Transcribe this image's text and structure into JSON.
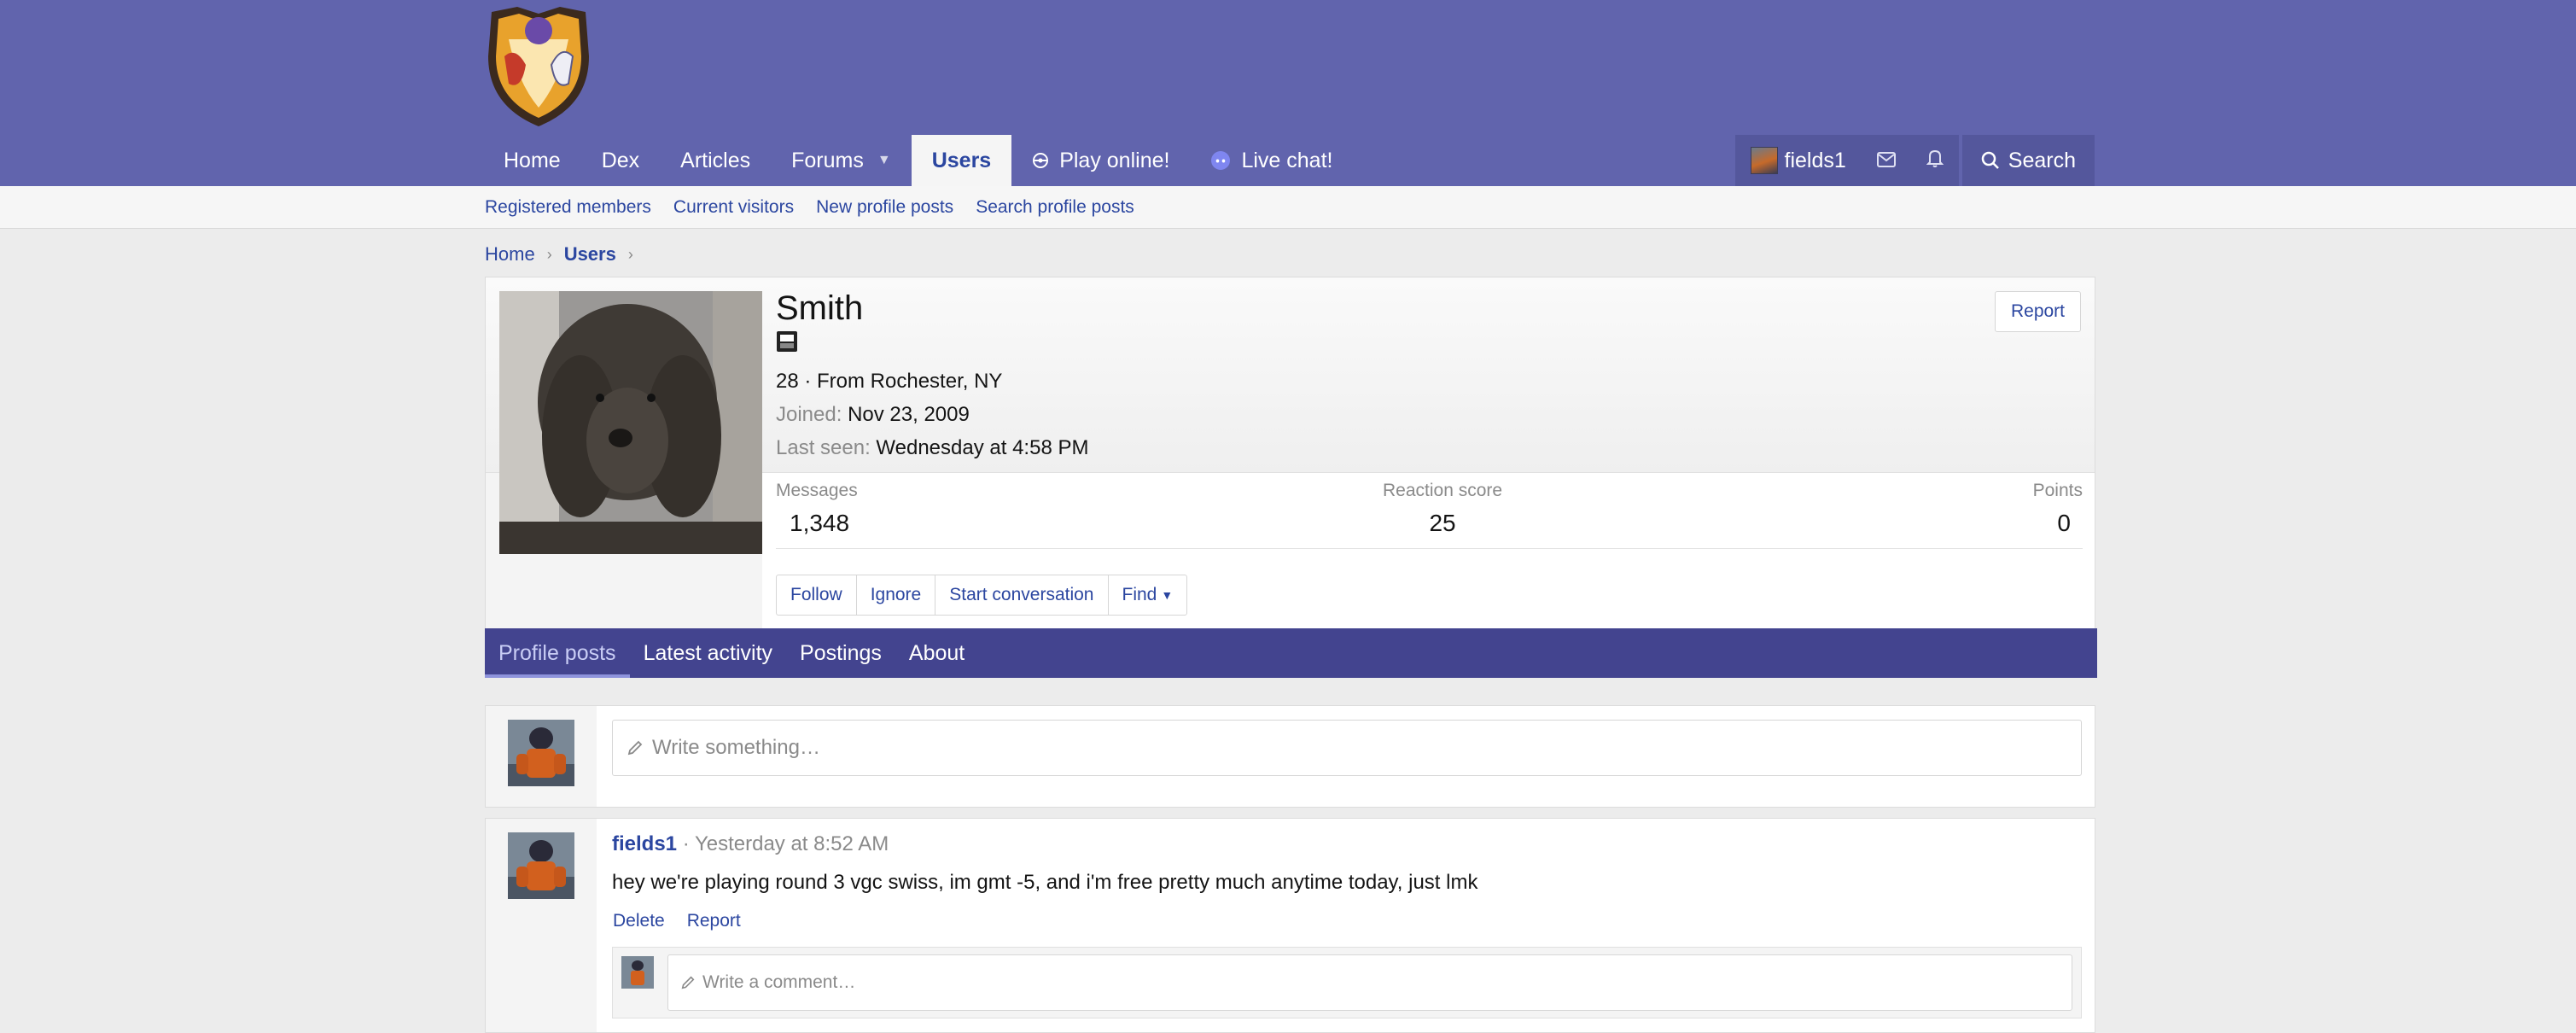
{
  "nav": {
    "items": [
      {
        "label": "Home"
      },
      {
        "label": "Dex"
      },
      {
        "label": "Articles"
      },
      {
        "label": "Forums"
      },
      {
        "label": "Users"
      },
      {
        "label": "Play online!"
      },
      {
        "label": "Live chat!"
      }
    ],
    "account_name": "fields1",
    "search_label": "Search"
  },
  "subnav": [
    "Registered members",
    "Current visitors",
    "New profile posts",
    "Search profile posts"
  ],
  "breadcrumb": [
    "Home",
    "Users"
  ],
  "profile": {
    "name": "Smith",
    "age_location": "28 · From Rochester, NY",
    "joined_label": "Joined:",
    "joined_value": "Nov 23, 2009",
    "last_seen_label": "Last seen:",
    "last_seen_value": "Wednesday at 4:58 PM",
    "report_label": "Report",
    "stats": {
      "messages_label": "Messages",
      "messages_value": "1,348",
      "reaction_label": "Reaction score",
      "reaction_value": "25",
      "points_label": "Points",
      "points_value": "0"
    },
    "actions": [
      "Follow",
      "Ignore",
      "Start conversation",
      "Find"
    ],
    "tabs": [
      "Profile posts",
      "Latest activity",
      "Postings",
      "About"
    ]
  },
  "composer": {
    "placeholder": "Write something…"
  },
  "post": {
    "author": "fields1",
    "time": "Yesterday at 8:52 AM",
    "body": "hey we're playing round 3 vgc swiss, im gmt -5, and i'm free pretty much anytime today, just lmk",
    "actions": [
      "Delete",
      "Report"
    ],
    "comment_placeholder": "Write a comment…"
  },
  "colors": {
    "header": "#6164ad",
    "tabs": "#43448f",
    "link": "#2b46a0"
  }
}
